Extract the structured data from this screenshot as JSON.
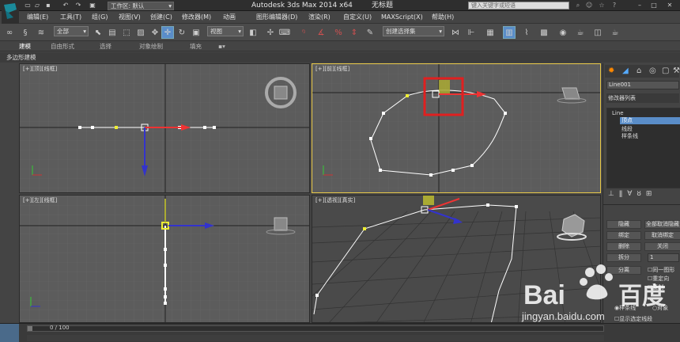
{
  "titlebar": {
    "workspace_label": "工作区: 默认",
    "app_title": "Autodesk 3ds Max  2014 x64",
    "document_title": "无标题",
    "search_placeholder": "键入关键字或短语"
  },
  "menu": [
    "编辑(E)",
    "工具(T)",
    "组(G)",
    "视图(V)",
    "创建(C)",
    "修改器(M)",
    "动画",
    "图形编辑器(D)",
    "渲染(R)",
    "自定义(U)",
    "MAXScript(X)",
    "帮助(H)"
  ],
  "toolbar": {
    "selection_filter": "全部",
    "reference_coord": "视图",
    "named_selection": "创建选择集"
  },
  "ribbon": {
    "tabs": [
      "建模",
      "自由形式",
      "选择",
      "对象绘制",
      "填充"
    ],
    "active_subtab": "多边形建模"
  },
  "viewports": {
    "top": "[+][顶][线框]",
    "front": "[+][前][线框]",
    "left": "[+][左][线框]",
    "perspective": "[+][透视][真实]"
  },
  "panel": {
    "object_name": "Line001",
    "modifier_list_label": "修改器列表",
    "stack": [
      "Line",
      "顶点",
      "线段",
      "样条线"
    ],
    "buttons": {
      "hide": "隐藏",
      "unhide_all": "全部取消隐藏",
      "bind": "绑定",
      "unbind": "取消绑定",
      "delete": "删除",
      "close": "关闭",
      "split": "拆分",
      "detach": "分离"
    },
    "split_value": "1",
    "checkboxes": [
      "同一图形",
      "重定向",
      "复制"
    ],
    "radio_options": [
      "样条线",
      "对象"
    ],
    "show_selected_segments": "显示选定线段"
  },
  "timeline": {
    "frame_label": "0 / 100"
  },
  "watermark": {
    "brand": "Bai",
    "brand_tail": "百度",
    "subtitle": "jingyan.baidu.com"
  },
  "colors": {
    "accent_blue": "#5a8dc8",
    "active_viewport_border": "#e8c848",
    "highlight_box": "#e02020"
  }
}
